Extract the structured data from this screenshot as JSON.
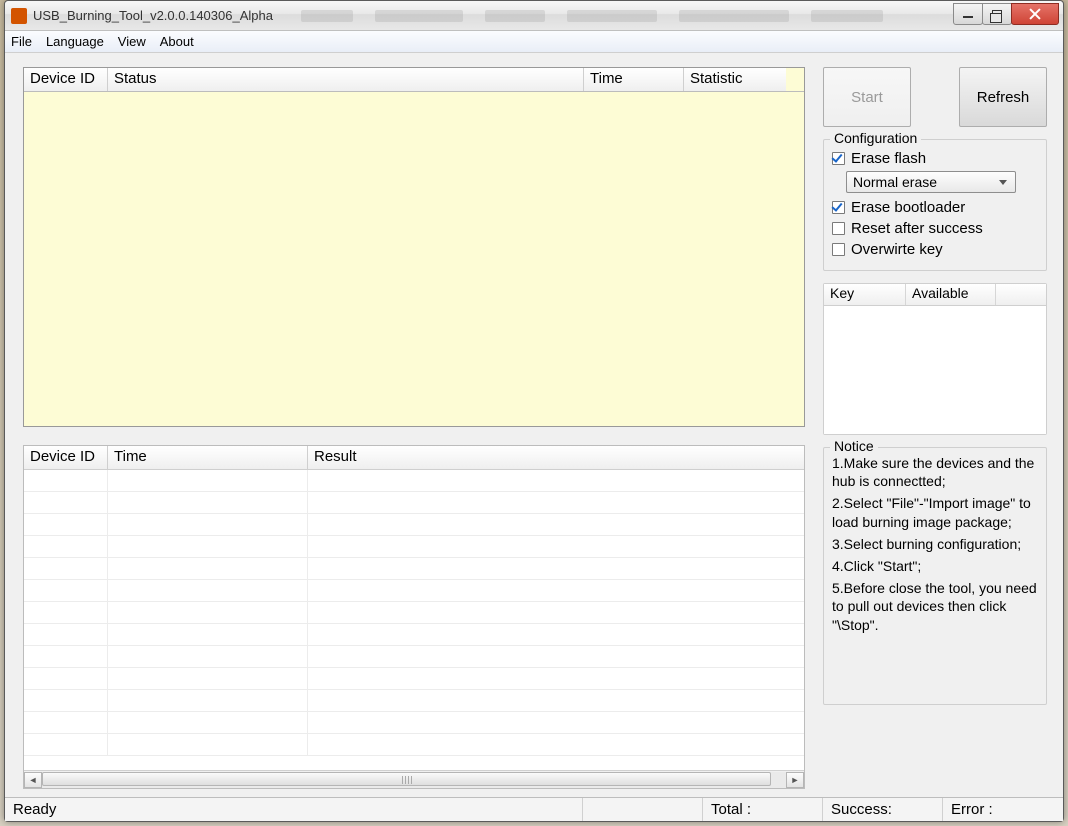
{
  "window": {
    "title": "USB_Burning_Tool_v2.0.0.140306_Alpha"
  },
  "menu": {
    "file": "File",
    "language": "Language",
    "view": "View",
    "about": "About"
  },
  "grid_top": {
    "cols": {
      "device_id": "Device ID",
      "status": "Status",
      "time": "Time",
      "statistic": "Statistic"
    }
  },
  "grid_bottom": {
    "cols": {
      "device_id": "Device ID",
      "time": "Time",
      "result": "Result"
    }
  },
  "buttons": {
    "start": "Start",
    "refresh": "Refresh"
  },
  "config": {
    "legend": "Configuration",
    "erase_flash": {
      "label": "Erase flash",
      "checked": true
    },
    "erase_mode": "Normal erase",
    "erase_bootloader": {
      "label": "Erase bootloader",
      "checked": true
    },
    "reset_after_success": {
      "label": "Reset after success",
      "checked": false
    },
    "overwrite_key": {
      "label": "Overwirte key",
      "checked": false
    }
  },
  "key_table": {
    "cols": {
      "key": "Key",
      "available": "Available"
    }
  },
  "notice": {
    "legend": "Notice",
    "lines": {
      "l1": "1.Make sure the devices and the hub is connectted;",
      "l2": "2.Select \"File\"-\"Import image\" to load burning image package;",
      "l3": "3.Select burning configuration;",
      "l4": "4.Click \"Start\";",
      "l5": "5.Before close the tool, you need to pull out devices then click \"\\Stop\"."
    }
  },
  "status": {
    "ready": "Ready",
    "total": "Total :",
    "success": "Success:",
    "error": "Error :"
  }
}
